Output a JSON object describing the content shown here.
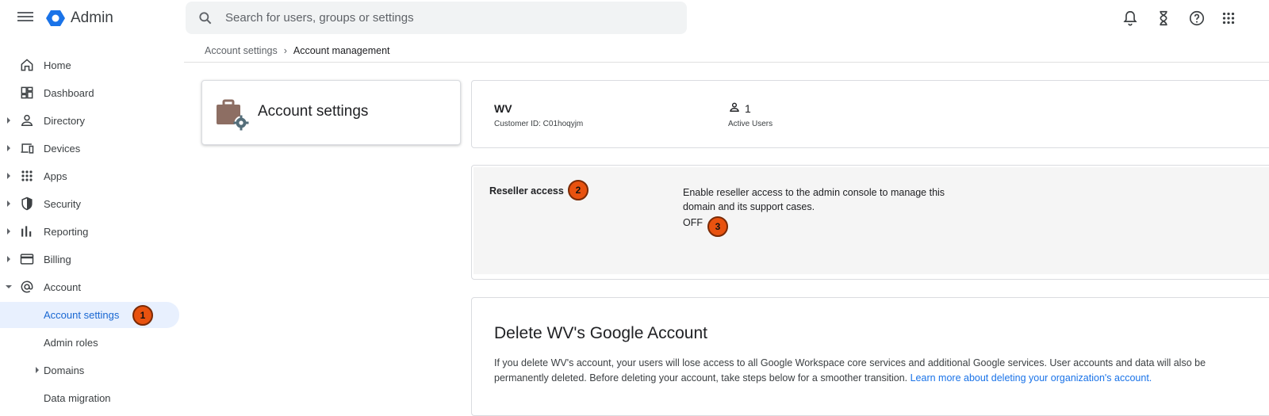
{
  "header": {
    "app_name": "Admin",
    "search_placeholder": "Search for users, groups or settings",
    "icons": [
      "menu-icon",
      "admin-logo-icon",
      "search-icon",
      "notifications-icon",
      "tasks-hourglass-icon",
      "help-icon",
      "apps-grid-icon"
    ]
  },
  "sidebar": {
    "items": [
      {
        "label": "Home",
        "icon": "home-icon"
      },
      {
        "label": "Dashboard",
        "icon": "dashboard-icon"
      },
      {
        "label": "Directory",
        "icon": "person-icon"
      },
      {
        "label": "Devices",
        "icon": "devices-icon"
      },
      {
        "label": "Apps",
        "icon": "apps-icon"
      },
      {
        "label": "Security",
        "icon": "shield-icon"
      },
      {
        "label": "Reporting",
        "icon": "bar-chart-icon"
      },
      {
        "label": "Billing",
        "icon": "credit-card-icon"
      },
      {
        "label": "Account",
        "icon": "at-sign-icon"
      }
    ],
    "subitems": [
      {
        "label": "Account settings",
        "active": true
      },
      {
        "label": "Admin roles"
      },
      {
        "label": "Domains"
      },
      {
        "label": "Data migration"
      }
    ]
  },
  "breadcrumb": {
    "parent": "Account settings",
    "separator": "›",
    "current": "Account management"
  },
  "account_card": {
    "title": "Account settings"
  },
  "info": {
    "org_name": "WV",
    "customer_id": "Customer ID: C01hoqyjm",
    "users_count": "1",
    "users_label": "Active Users"
  },
  "reseller": {
    "name": "Reseller access",
    "description": "Enable reseller access to the admin console to manage this domain and its support cases.",
    "state": "OFF"
  },
  "delete_section": {
    "title": "Delete WV's Google Account",
    "body": "If you delete WV's account, your users will lose access to all Google Workspace core services and additional Google services. User accounts and data will also be permanently deleted. Before deleting your account, take steps below for a smoother transition. ",
    "link": "Learn more about deleting your organization's account."
  },
  "annotations": [
    "1",
    "2",
    "3"
  ],
  "colors": {
    "accent": "#1a73e8",
    "active_bg": "#e8f0fe",
    "badge": "#e8520f",
    "reseller_bg": "#f5f5f5",
    "briefcase": "#8d6e63"
  }
}
